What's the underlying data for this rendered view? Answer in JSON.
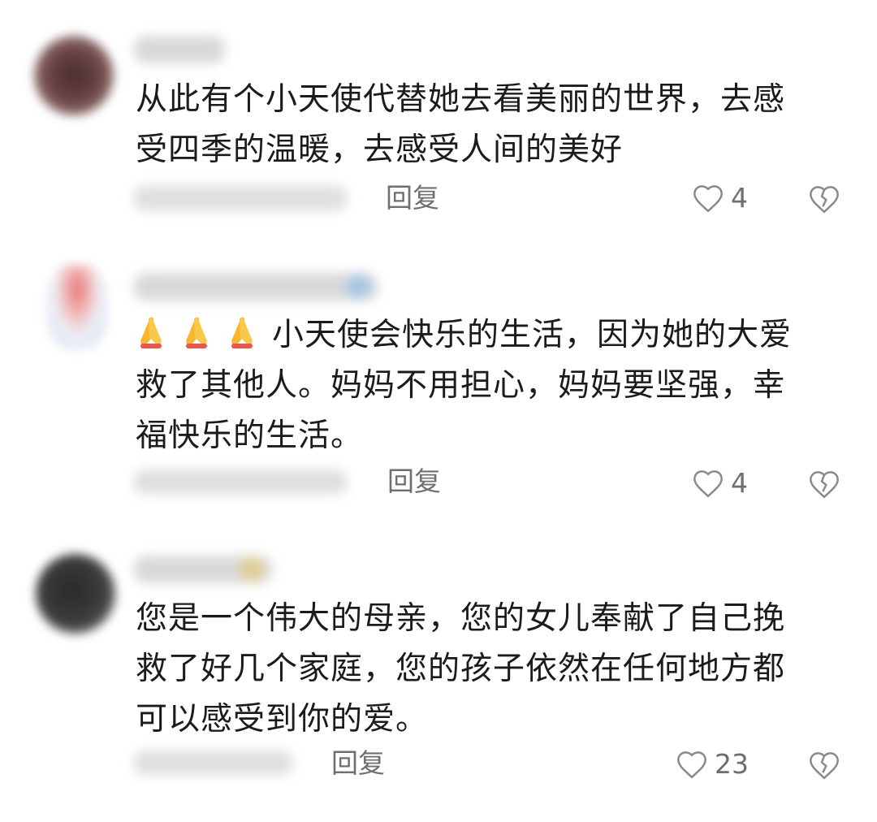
{
  "comments": [
    {
      "lines": [
        "从此有个小天使代替她去看美丽的世界，去感",
        "受四季的温暖，去感受人间的美好"
      ],
      "reply_label": "回复",
      "like_count": "4"
    },
    {
      "lines": [
        "小天使会快乐的生活，因为她的大爱",
        "救了其他人。妈妈不用担心，妈妈要坚强，幸",
        "福快乐的生活。"
      ],
      "emoji": "folded-hands-emoji",
      "emoji_count": 3,
      "reply_label": "回复",
      "like_count": "4"
    },
    {
      "lines": [
        "您是一个伟大的母亲，您的女儿奉献了自己挽",
        "救了好几个家庭，您的孩子依然在任何地方都",
        "可以感受到你的爱。"
      ],
      "reply_label": "回复",
      "like_count": "23"
    }
  ],
  "icons": {
    "like": "heart-outline-icon",
    "dislike": "broken-heart-outline-icon",
    "icon_color": "#8a8a8a"
  }
}
